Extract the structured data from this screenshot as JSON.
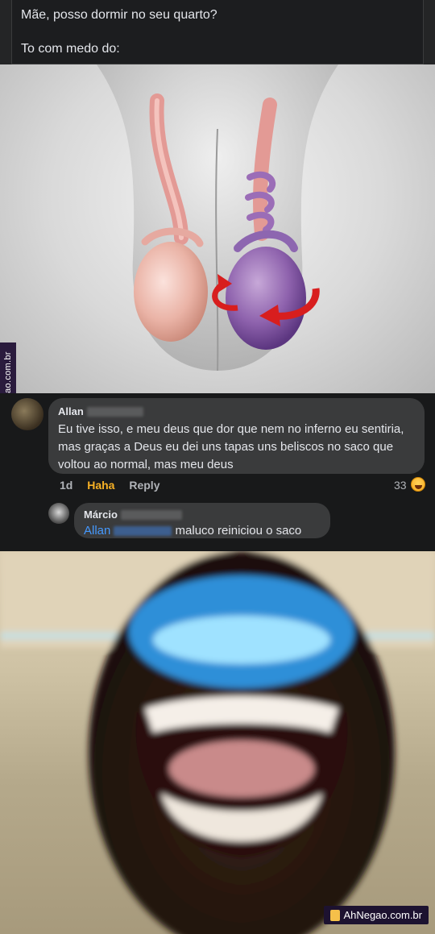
{
  "post": {
    "line1": "Mãe, posso dormir no seu quarto?",
    "line2": "To com medo do:"
  },
  "watermark_side": "AhNegao.com.br",
  "comments": [
    {
      "author": "Allan",
      "text": "Eu tive isso, e meu deus que dor que nem no inferno eu sentiria, mas graças a Deus eu dei uns tapas uns beliscos no saco que voltou ao normal, mas meu deus",
      "time": "1d",
      "reaction_label": "Haha",
      "reply_label": "Reply",
      "reaction_count": "33",
      "reaction_icon": "laughing-emoji-icon"
    },
    {
      "author": "Márcio",
      "mention": "Allan",
      "text": "maluco reiniciou o saco"
    }
  ],
  "watermark_bottom": "AhNegao.com.br"
}
